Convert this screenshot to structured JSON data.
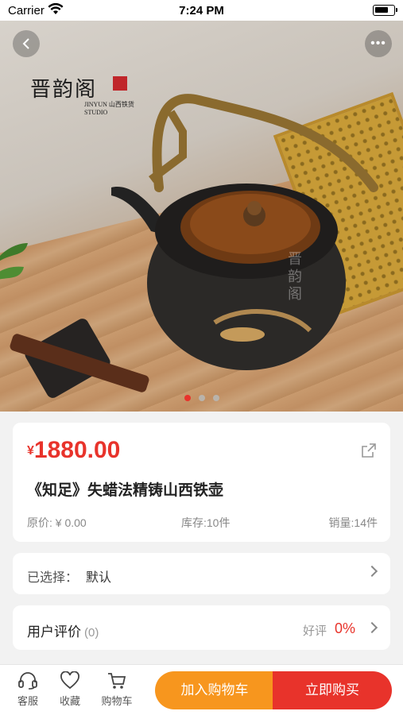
{
  "status_bar": {
    "carrier": "Carrier",
    "time": "7:24 PM"
  },
  "hero": {
    "brand_name": "晋韵阁",
    "brand_sub_en": "JINYUN",
    "brand_sub_en2": "STUDIO",
    "brand_sub_cn": "山西铁货",
    "watermark": "晋韵阁",
    "carousel": {
      "count": 3,
      "active_index": 0
    }
  },
  "product": {
    "currency": "¥",
    "price": "1880.00",
    "title": "《知足》失蜡法精铸山西铁壶",
    "original_price": "原价: ¥ 0.00",
    "stock": "库存:10件",
    "sales": "销量:14件"
  },
  "selection": {
    "label": "已选择：",
    "value": "默认"
  },
  "reviews": {
    "label": "用户评价",
    "count": "(0)",
    "good_label": "好评",
    "good_value": "0%"
  },
  "bottom_bar": {
    "service": "客服",
    "favorite": "收藏",
    "cart": "购物车",
    "add_to_cart": "加入购物车",
    "buy_now": "立即购买"
  },
  "colors": {
    "accent": "#e8332b",
    "secondary": "#f7961e"
  },
  "icons": [
    "wifi-icon",
    "battery-icon",
    "back-icon",
    "more-icon",
    "share-icon",
    "chevron-right-icon",
    "headset-icon",
    "heart-icon",
    "cart-icon"
  ]
}
